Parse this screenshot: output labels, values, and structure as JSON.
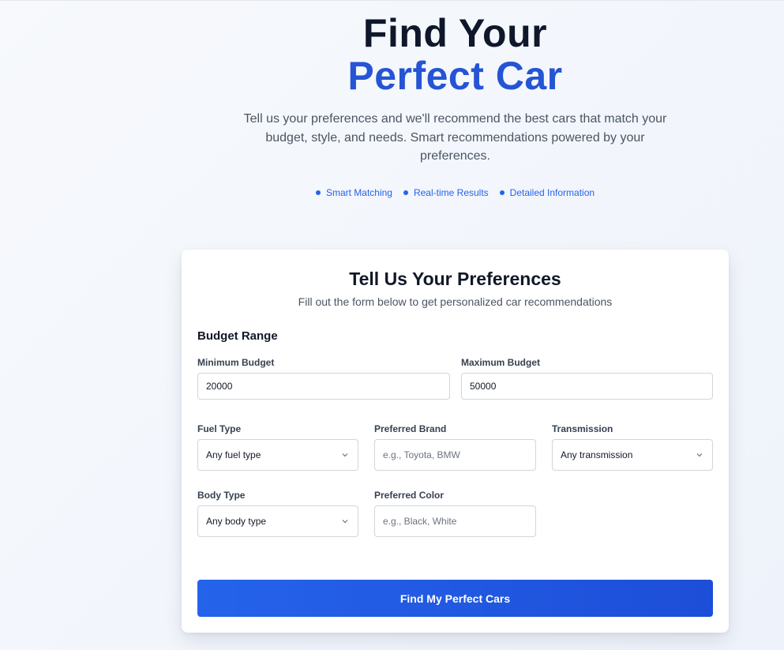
{
  "hero": {
    "title_line1": "Find Your",
    "title_line2": "Perfect Car",
    "subtitle": "Tell us your preferences and we'll recommend the best cars that match your budget, style, and needs. Smart recommendations powered by your preferences.",
    "features": [
      "Smart Matching",
      "Real-time Results",
      "Detailed Information"
    ]
  },
  "form": {
    "title": "Tell Us Your Preferences",
    "subtitle": "Fill out the form below to get personalized car recommendations",
    "budget_section": "Budget Range",
    "min_budget": {
      "label": "Minimum Budget",
      "value": "20000"
    },
    "max_budget": {
      "label": "Maximum Budget",
      "value": "50000"
    },
    "fuel_type": {
      "label": "Fuel Type",
      "value": "Any fuel type"
    },
    "brand": {
      "label": "Preferred Brand",
      "placeholder": "e.g., Toyota, BMW"
    },
    "transmission": {
      "label": "Transmission",
      "value": "Any transmission"
    },
    "body_type": {
      "label": "Body Type",
      "value": "Any body type"
    },
    "color": {
      "label": "Preferred Color",
      "placeholder": "e.g., Black, White"
    },
    "submit_label": "Find My Perfect Cars"
  },
  "colors": {
    "accent": "#2563eb",
    "title_blue": "#2554d4",
    "dark": "#0f172a"
  },
  "icons": {
    "dropdown": "chevron-down-icon",
    "feature_bullet": "dot-icon"
  }
}
